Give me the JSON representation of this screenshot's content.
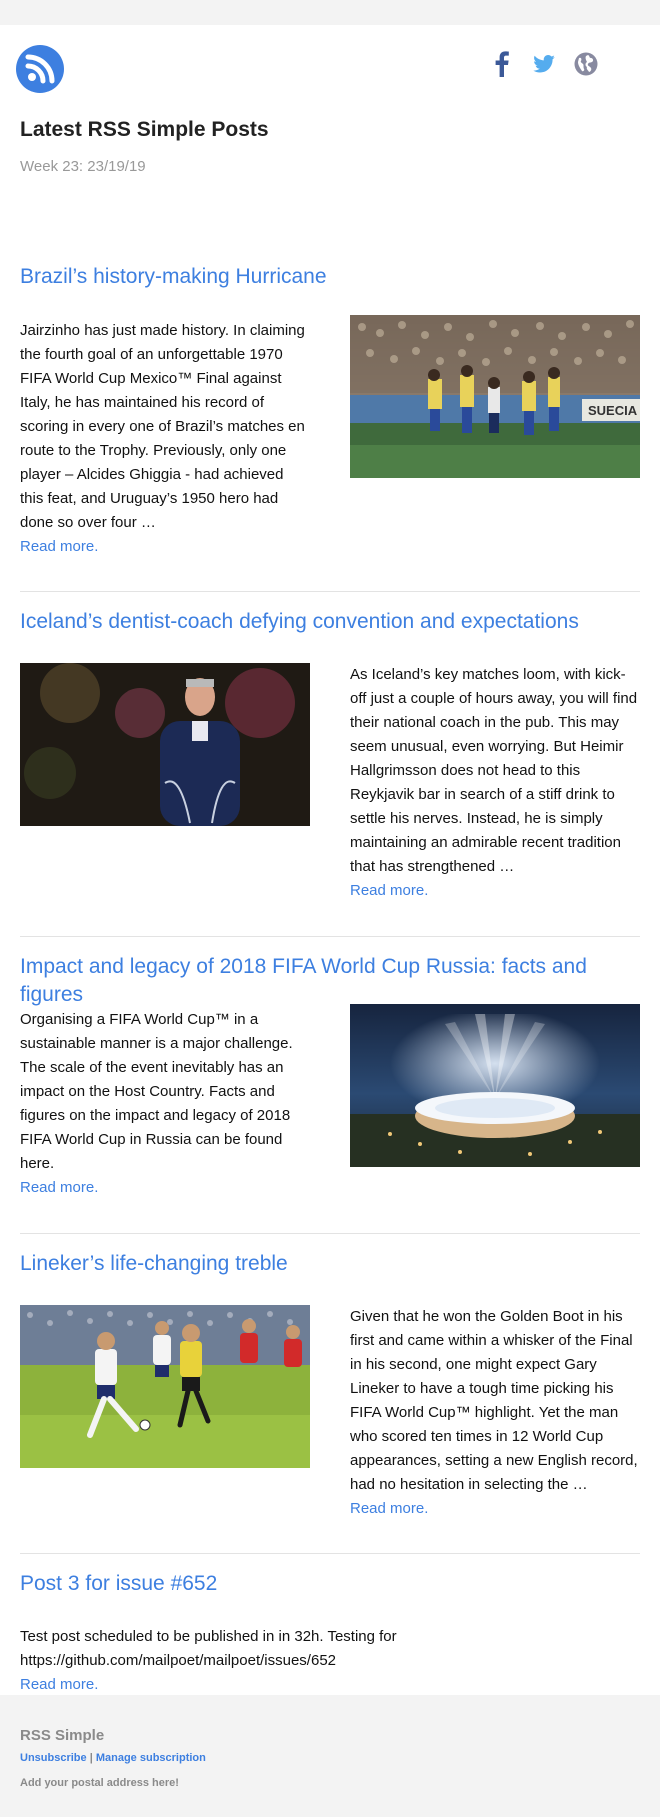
{
  "header": {
    "title": "Latest RSS Simple Posts",
    "subtitle": "Week 23: 23/19/19",
    "logo_icon": "rss-icon",
    "socials": [
      {
        "name": "facebook-icon",
        "color": "#3b5998"
      },
      {
        "name": "twitter-icon",
        "color": "#55acee"
      },
      {
        "name": "globe-icon",
        "color": "#888aa0"
      }
    ]
  },
  "posts": [
    {
      "title": "Brazil’s history-making Hurricane",
      "excerpt": "Jairzinho has just made history. In claiming the fourth goal of an unforgettable 1970 FIFA World Cup Mexico™ Final against Italy, he has maintained his record of scoring in every one of Brazil’s matches en route to the Trophy. Previously, only one player – Alcides Ghiggia - had achieved this feat, and Uruguay’s 1950 hero had done so over four …",
      "read_more": "Read more.",
      "image_sign": "SUECIA"
    },
    {
      "title": "Iceland’s dentist-coach defying convention and expectations",
      "excerpt": "As Iceland’s key matches loom, with kick-off just a couple of hours away, you will find their national coach in the pub. This may seem unusual, even worrying. But Heimir Hallgrimsson does not head to this Reykjavik bar in search of a stiff drink to settle his nerves. Instead, he is simply maintaining an admirable recent tradition that has strengthened …",
      "read_more": "Read more."
    },
    {
      "title": "Impact and legacy of 2018 FIFA World Cup Russia: facts and figures",
      "excerpt": "Organising a FIFA World Cup™ in a sustainable manner is a major challenge. The scale of the event inevitably has an impact on the Host Country. Facts and figures on the impact and legacy of 2018 FIFA World Cup in Russia can be found here.",
      "read_more": "Read more."
    },
    {
      "title": "Lineker’s life-changing treble",
      "excerpt": "Given that he won the Golden Boot in his first and came within a whisker of the Final in his second, one might expect Gary Lineker to have a tough time picking his FIFA World Cup™ highlight. Yet the man who scored ten times in 12 World Cup appearances, setting a new English record, had no hesitation in selecting the …",
      "read_more": "Read more."
    },
    {
      "title": "Post 3 for issue #652",
      "excerpt": "Test post scheduled to be published in in 32h. Testing for https://github.com/mailpoet/mailpoet/issues/652",
      "read_more": "Read more."
    }
  ],
  "footer": {
    "title": "RSS Simple",
    "unsubscribe": "Unsubscribe",
    "separator": "|",
    "manage": "Manage subscription",
    "address": "Add your postal address here!"
  },
  "colors": {
    "accent": "#3d7fe0",
    "background": "#f3f3f3",
    "muted": "#999999"
  }
}
